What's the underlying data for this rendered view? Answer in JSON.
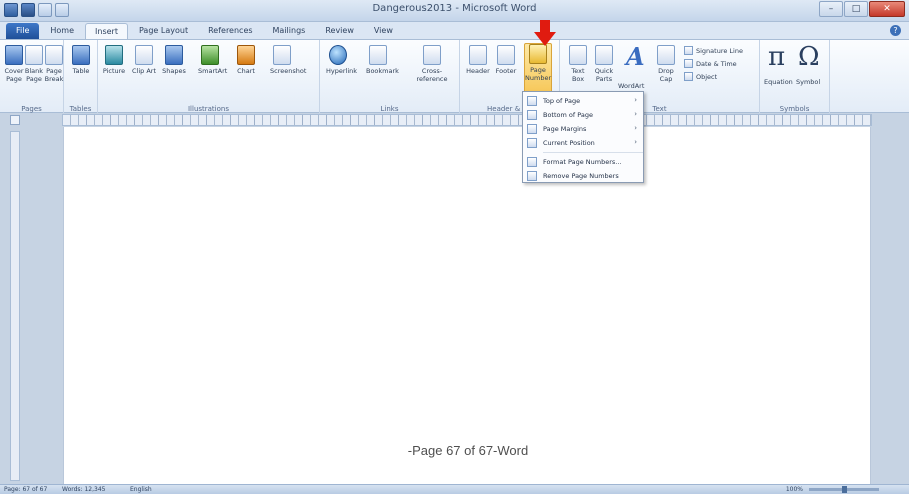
{
  "window": {
    "title": "Dangerous2013 - Microsoft Word"
  },
  "window_controls": {
    "minimize": "–",
    "maximize": "□",
    "close": "✕"
  },
  "tabs": [
    "File",
    "Home",
    "Insert",
    "Page Layout",
    "References",
    "Mailings",
    "Review",
    "View"
  ],
  "active_tab": "Insert",
  "ribbon": {
    "pages": {
      "label": "Pages",
      "buttons": [
        "Cover Page",
        "Blank Page",
        "Page Break"
      ]
    },
    "tables": {
      "label": "Tables",
      "buttons": [
        "Table"
      ]
    },
    "illustrations": {
      "label": "Illustrations",
      "buttons": [
        "Picture",
        "Clip Art",
        "Shapes",
        "SmartArt",
        "Chart",
        "Screenshot"
      ]
    },
    "links": {
      "label": "Links",
      "buttons": [
        "Hyperlink",
        "Bookmark",
        "Cross-reference"
      ]
    },
    "header_footer": {
      "label": "Header & F...",
      "buttons": [
        "Header",
        "Footer",
        "Page Number"
      ]
    },
    "text": {
      "label": "Text",
      "buttons": [
        "Text Box",
        "Quick Parts",
        "WordArt",
        "Drop Cap"
      ],
      "small": [
        "Signature Line",
        "Date & Time",
        "Object"
      ]
    },
    "symbols": {
      "label": "Symbols",
      "buttons": [
        "Equation",
        "Symbol"
      ],
      "equation_glyph": "π",
      "symbol_glyph": "Ω"
    }
  },
  "page_number_menu": {
    "items": [
      {
        "label": "Top of Page",
        "submenu": true
      },
      {
        "label": "Bottom of Page",
        "submenu": true
      },
      {
        "label": "Page Margins",
        "submenu": true
      },
      {
        "label": "Current Position",
        "submenu": true
      },
      {
        "label": "Format Page Numbers...",
        "submenu": false
      },
      {
        "label": "Remove Page Numbers",
        "submenu": false
      }
    ],
    "submenu_arrow": "›"
  },
  "document": {
    "footer_text": "-Page 67 of 67-Word"
  },
  "statusbar": {
    "page": "Page: 67 of 67",
    "words": "Words: 12,345",
    "language": "English",
    "zoom": "100%"
  },
  "colors": {
    "accent": "#2f5f9f",
    "arrow": "#e01b10",
    "highlight": "#f7c85a"
  }
}
